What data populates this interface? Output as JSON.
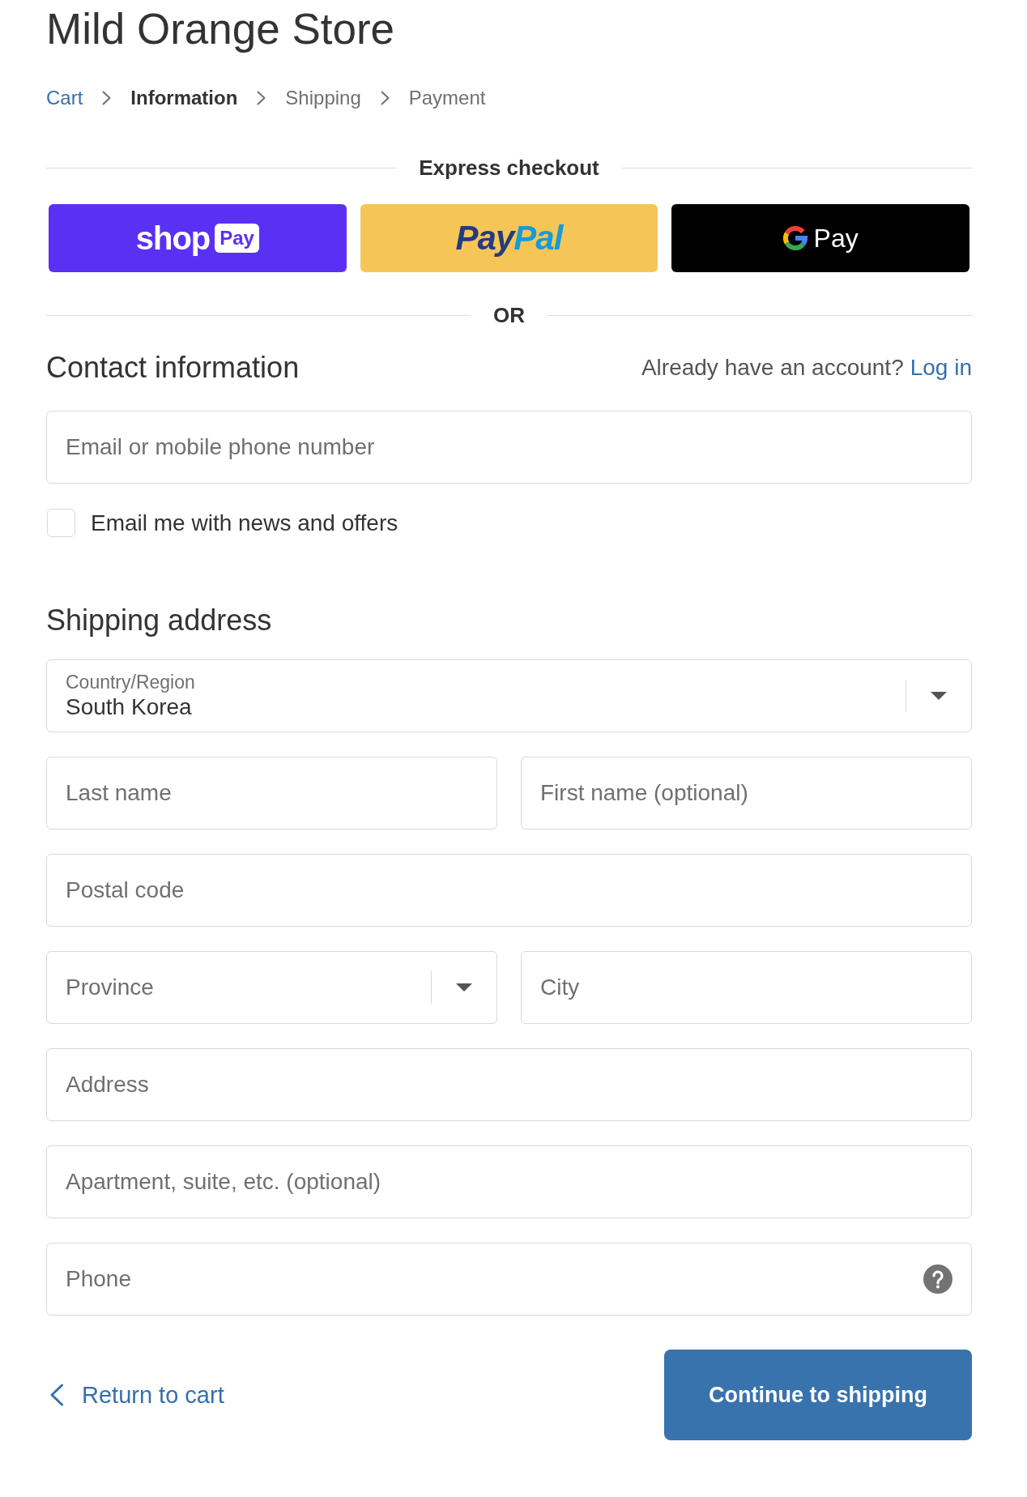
{
  "store": {
    "title": "Mild Orange Store"
  },
  "breadcrumb": [
    {
      "label": "Cart",
      "kind": "link"
    },
    {
      "label": "Information",
      "kind": "current"
    },
    {
      "label": "Shipping",
      "kind": "upcoming"
    },
    {
      "label": "Payment",
      "kind": "upcoming"
    }
  ],
  "express_checkout": {
    "title": "Express checkout",
    "buttons": [
      {
        "kind": "shop_pay",
        "text": "shop",
        "badge": "Pay"
      },
      {
        "kind": "paypal",
        "text": "Pay",
        "text_accent": "Pal"
      },
      {
        "kind": "google_pay",
        "text": "Pay"
      }
    ]
  },
  "separator": {
    "label": "OR"
  },
  "contact": {
    "heading": "Contact information",
    "account_prompt": "Already have an account?",
    "login_link": "Log in",
    "email": {
      "placeholder": "Email or mobile phone number"
    },
    "newsletter": {
      "label": "Email me with news and offers",
      "checked": false
    }
  },
  "shipping": {
    "heading": "Shipping address",
    "rows": [
      {
        "fields": [
          {
            "kind": "select",
            "label": "Country/Region",
            "value": "South Korea"
          }
        ]
      },
      {
        "fields": [
          {
            "kind": "text",
            "placeholder": "Last name"
          },
          {
            "kind": "text",
            "placeholder": "First name (optional)"
          }
        ]
      },
      {
        "fields": [
          {
            "kind": "text",
            "placeholder": "Postal code"
          }
        ]
      },
      {
        "fields": [
          {
            "kind": "select",
            "placeholder": "Province"
          },
          {
            "kind": "text",
            "placeholder": "City"
          }
        ]
      },
      {
        "fields": [
          {
            "kind": "text",
            "placeholder": "Address"
          }
        ]
      },
      {
        "fields": [
          {
            "kind": "text",
            "placeholder": "Apartment, suite, etc. (optional)"
          }
        ]
      },
      {
        "fields": [
          {
            "kind": "help",
            "placeholder": "Phone"
          }
        ]
      }
    ]
  },
  "actions": {
    "back_link": "Return to cart",
    "continue_button": "Continue to shipping"
  }
}
